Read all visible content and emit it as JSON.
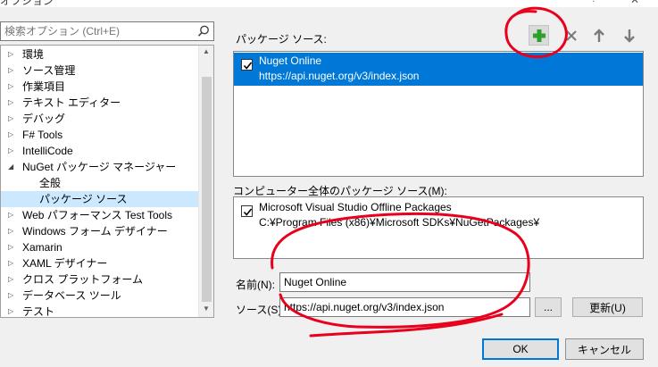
{
  "window": {
    "title": "オプション",
    "help_glyph": "?",
    "close_glyph": "✕"
  },
  "search": {
    "placeholder": "検索オプション (Ctrl+E)"
  },
  "tree": {
    "items": [
      {
        "label": "環境",
        "expandable": true
      },
      {
        "label": "ソース管理",
        "expandable": true
      },
      {
        "label": "作業項目",
        "expandable": true
      },
      {
        "label": "テキスト エディター",
        "expandable": true
      },
      {
        "label": "デバッグ",
        "expandable": true
      },
      {
        "label": "F# Tools",
        "expandable": true
      },
      {
        "label": "IntelliCode",
        "expandable": true
      },
      {
        "label": "NuGet パッケージ マネージャー",
        "expandable": true,
        "expanded": true
      },
      {
        "label": "全般",
        "child": true
      },
      {
        "label": "パッケージ ソース",
        "child": true,
        "selected": true
      },
      {
        "label": "Web パフォーマンス Test Tools",
        "expandable": true
      },
      {
        "label": "Windows フォーム デザイナー",
        "expandable": true
      },
      {
        "label": "Xamarin",
        "expandable": true
      },
      {
        "label": "XAML デザイナー",
        "expandable": true
      },
      {
        "label": "クロス プラットフォーム",
        "expandable": true
      },
      {
        "label": "データベース ツール",
        "expandable": true
      },
      {
        "label": "テスト",
        "expandable": true
      }
    ]
  },
  "package_sources": {
    "label": "パッケージ ソース:",
    "items": [
      {
        "name": "Nuget Online",
        "url": "https://api.nuget.org/v3/index.json",
        "checked": true,
        "selected": true
      }
    ]
  },
  "machine_sources": {
    "label": "コンピューター全体のパッケージ ソース(M):",
    "items": [
      {
        "name": "Microsoft Visual Studio Offline Packages",
        "path": "C:¥Program Files (x86)¥Microsoft SDKs¥NuGetPackages¥",
        "checked": true
      }
    ]
  },
  "toolbar": {
    "add_icon": "plus-icon",
    "remove_icon": "x-icon",
    "up_icon": "arrow-up-icon",
    "down_icon": "arrow-down-icon"
  },
  "form": {
    "name_label": "名前(N):",
    "name_value": "Nuget Online",
    "source_label": "ソース(S):",
    "source_value": "https://api.nuget.org/v3/index.json",
    "browse_label": "...",
    "update_label": "更新(U)"
  },
  "footer": {
    "ok_label": "OK",
    "cancel_label": "キャンセル"
  },
  "colors": {
    "selection": "#0078d7",
    "tree_selection": "#cce8ff",
    "add_green": "#2ca02c",
    "annotation_red": "#e8001c"
  }
}
